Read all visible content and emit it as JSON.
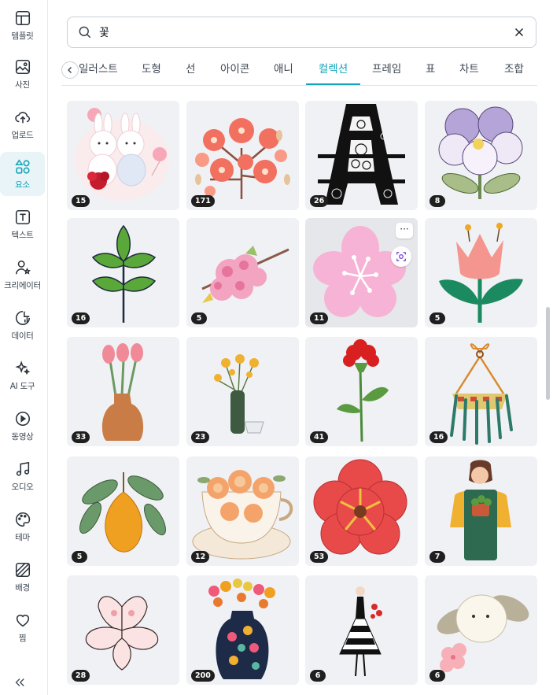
{
  "sidebar": {
    "items": [
      {
        "label": "템플릿",
        "icon": "template-icon"
      },
      {
        "label": "사진",
        "icon": "photo-icon"
      },
      {
        "label": "업로드",
        "icon": "upload-icon"
      },
      {
        "label": "요소",
        "icon": "elements-icon",
        "active": true
      },
      {
        "label": "텍스트",
        "icon": "text-icon"
      },
      {
        "label": "크리에이터",
        "icon": "creator-icon"
      },
      {
        "label": "데이터",
        "icon": "data-icon"
      },
      {
        "label": "AI 도구",
        "icon": "ai-tools-icon"
      },
      {
        "label": "동영상",
        "icon": "video-icon"
      },
      {
        "label": "오디오",
        "icon": "audio-icon"
      },
      {
        "label": "테마",
        "icon": "palette-icon"
      },
      {
        "label": "배경",
        "icon": "background-icon"
      },
      {
        "label": "찜",
        "icon": "heart-icon"
      }
    ]
  },
  "search": {
    "query": "꽃"
  },
  "tabs": [
    {
      "label": "일러스트"
    },
    {
      "label": "도형"
    },
    {
      "label": "선"
    },
    {
      "label": "아이콘"
    },
    {
      "label": "애니"
    },
    {
      "label": "컬렉션",
      "active": true
    },
    {
      "label": "프레임"
    },
    {
      "label": "표"
    },
    {
      "label": "차트"
    },
    {
      "label": "조합"
    }
  ],
  "results": [
    {
      "count": "15",
      "subject": "bunny-couple-illustration"
    },
    {
      "count": "171",
      "subject": "cherry-blossom-illustration"
    },
    {
      "count": "26",
      "subject": "floral-letter-a"
    },
    {
      "count": "8",
      "subject": "pansy-flower"
    },
    {
      "count": "16",
      "subject": "green-leaf-branch"
    },
    {
      "count": "5",
      "subject": "pink-blossom-branch"
    },
    {
      "count": "11",
      "subject": "pink-sakura-flower"
    },
    {
      "count": "5",
      "subject": "pink-tulip"
    },
    {
      "count": "33",
      "subject": "tulips-in-vase"
    },
    {
      "count": "23",
      "subject": "yellow-flowers-in-bottle"
    },
    {
      "count": "41",
      "subject": "red-carnation"
    },
    {
      "count": "16",
      "subject": "hanging-plant-basket"
    },
    {
      "count": "5",
      "subject": "yellow-fruit-branch"
    },
    {
      "count": "12",
      "subject": "floral-teacup"
    },
    {
      "count": "53",
      "subject": "red-hibiscus-flower"
    },
    {
      "count": "7",
      "subject": "gardener-woman"
    },
    {
      "count": "28",
      "subject": "magnolia-sketch"
    },
    {
      "count": "200",
      "subject": "heart-flower-vase"
    },
    {
      "count": "6",
      "subject": "woman-striped-dress"
    },
    {
      "count": "6",
      "subject": "bird-with-blossom"
    }
  ],
  "card_actions": {
    "more_label": "···"
  },
  "colors": {
    "accent": "#13a3b8",
    "card_bg": "#f0f1f4"
  }
}
